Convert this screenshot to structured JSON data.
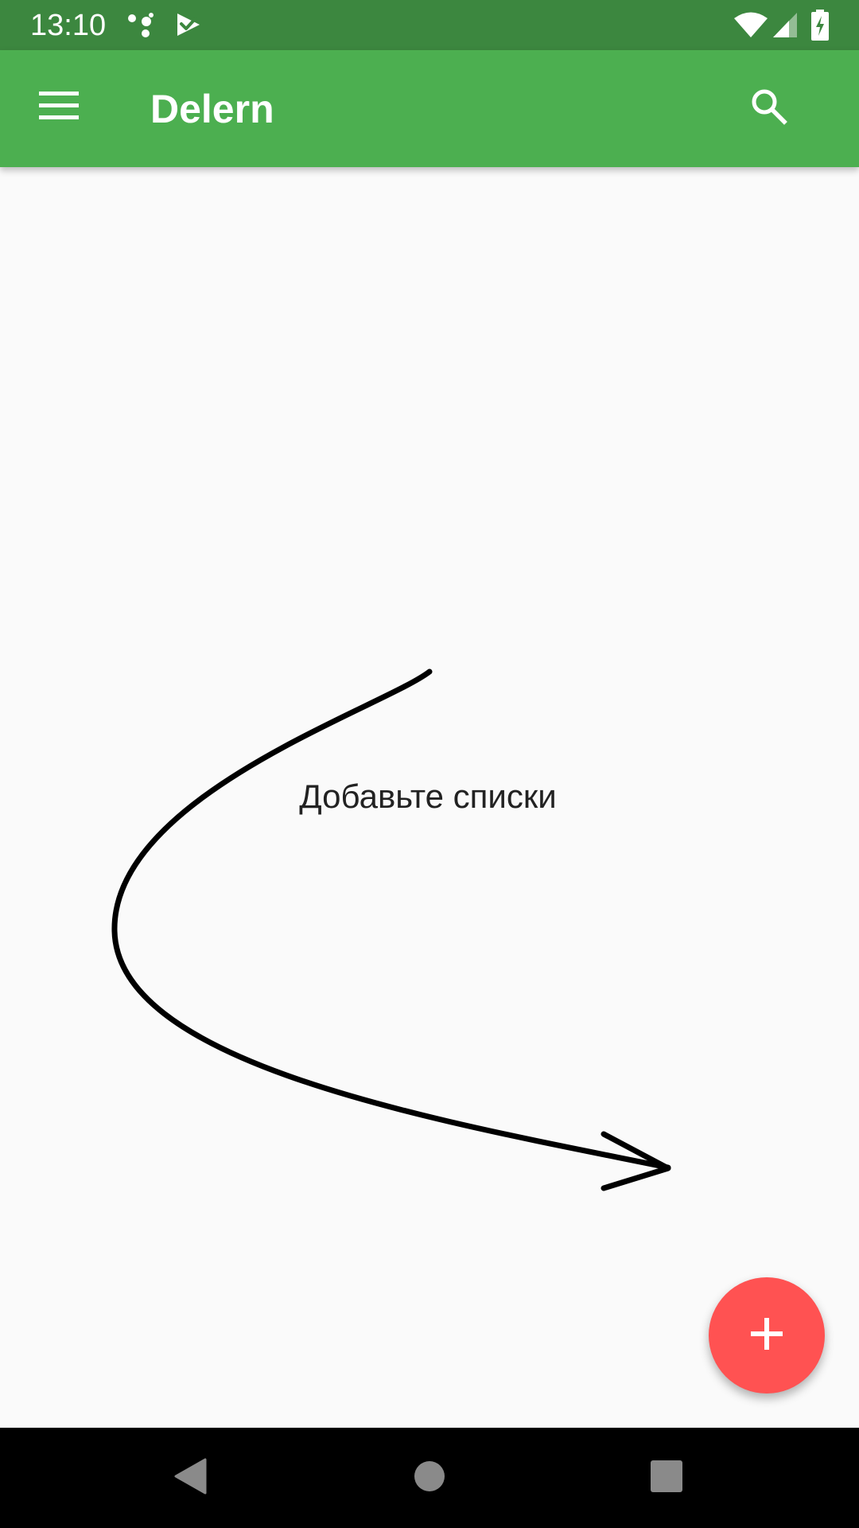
{
  "status_bar": {
    "time": "13:10",
    "icons": [
      "assistant-dots-icon",
      "task-check-icon",
      "wifi-icon",
      "cellular-signal-icon",
      "battery-charging-icon"
    ],
    "background": "#3c873f"
  },
  "app_bar": {
    "title": "Delern",
    "menu_icon": "menu-icon",
    "search_icon": "search-icon",
    "background": "#4caf50"
  },
  "main": {
    "empty_message": "Добавьте списки",
    "arrow_icon": "hand-drawn-arrow-icon"
  },
  "fab": {
    "icon": "plus-icon",
    "color": "#ff5252"
  },
  "nav_bar": {
    "icons": [
      "back-icon",
      "home-icon",
      "recents-icon"
    ],
    "icon_color": "#8a8a8a"
  }
}
